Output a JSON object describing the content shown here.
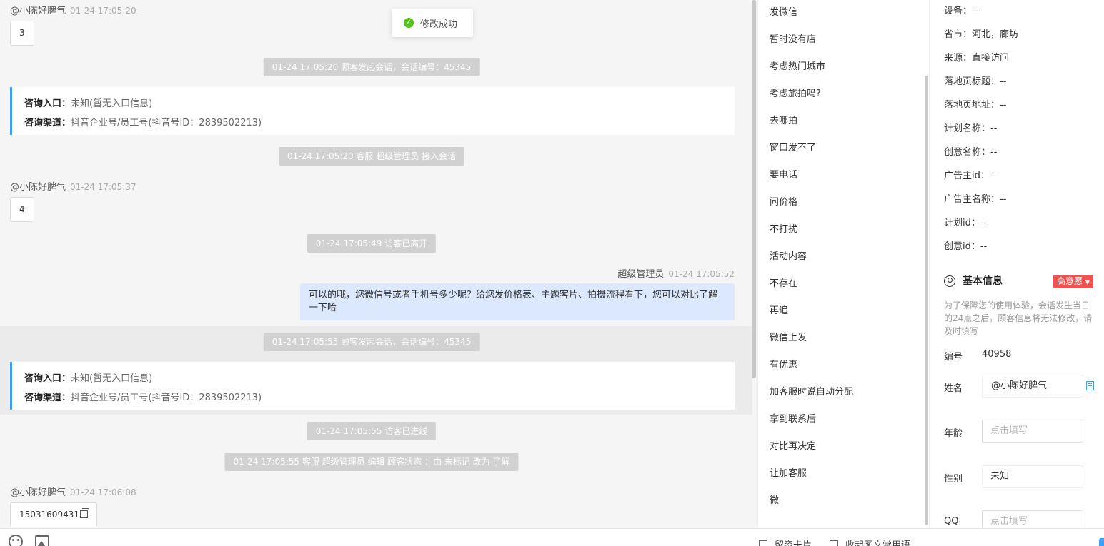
{
  "toast": {
    "text": "修改成功"
  },
  "chat": {
    "messages": [
      {
        "sender": "@小陈好脾气",
        "time": "01-24 17:05:20",
        "text": "3"
      },
      {
        "sender": "@小陈好脾气",
        "time": "01-24 17:05:37",
        "text": "4"
      },
      {
        "sender": "@小陈好脾气",
        "time": "01-24 17:06:08",
        "text": "15031609431"
      }
    ],
    "system": [
      "01-24 17:05:20 顾客发起会话，会话编号：45345",
      "01-24 17:05:20 客服 超级管理员 接入会话",
      "01-24 17:05:49 访客已离开",
      "01-24 17:05:55 顾客发起会话，会话编号：45345",
      "01-24 17:05:55 访客已进线",
      "01-24 17:05:55 客服 超级管理员 编辑 顾客状态 ：由 未标记 改为 了解"
    ],
    "cards": [
      {
        "entry_label": "咨询入口：",
        "entry_value": "未知(暂无入口信息)",
        "channel_label": "咨询渠道：",
        "channel_value": "抖音企业号/员工号(抖音号ID：2839502213)"
      },
      {
        "entry_label": "咨询入口：",
        "entry_value": "未知(暂无入口信息)",
        "channel_label": "咨询渠道：",
        "channel_value": "抖音企业号/员工号(抖音号ID：2839502213)"
      }
    ],
    "agent": {
      "name": "超级管理员",
      "time": "01-24 17:05:52",
      "text": "可以的哦，您微信号或者手机号多少呢？给您发价格表、主题客片、拍摄流程看下，您可以对比了解一下哈"
    }
  },
  "toolbar": {
    "emoji_icon": "emoji-icon",
    "image_icon": "image-icon",
    "leave_card": "留资卡片",
    "collapse_phrases": "收起图文常用语"
  },
  "quick_replies": [
    "发微信",
    "暂时没有店",
    "考虑热门城市",
    "考虑旅拍吗?",
    "去哪拍",
    "窗口发不了",
    "要电话",
    "问价格",
    "不打扰",
    "活动内容",
    "不存在",
    "再追",
    "微信上发",
    "有优惠",
    "加客服时说自动分配",
    "拿到联系后",
    "对比再决定",
    "让加客服",
    "微"
  ],
  "info": {
    "details": [
      "设备：--",
      "省市：河北，廊坊",
      "来源：直接访问",
      "落地页标题：--",
      "落地页地址：--",
      "计划名称：--",
      "创意名称：--",
      "广告主id：--",
      "广告主名称：--",
      "计划id：--",
      "创意id：--"
    ],
    "basic_title": "基本信息",
    "intent_badge": "高意愿",
    "notice": "为了保障您的使用体验，会话发生当日的24点之后，顾客信息将无法修改，请及时填写",
    "id_label": "编号",
    "id_value": "40958",
    "name_label": "姓名",
    "name_value": "@小陈好脾气",
    "age_label": "年龄",
    "age_placeholder": "点击填写",
    "gender_label": "性别",
    "gender_value": "未知",
    "qq_label": "QQ",
    "qq_placeholder": "点击填写",
    "accent_color": "#409eff",
    "badge_color": "#f25151"
  }
}
